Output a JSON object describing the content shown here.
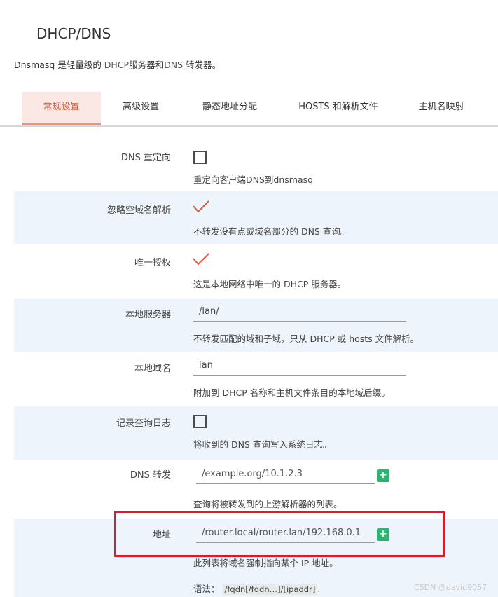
{
  "page": {
    "title": "DHCP/DNS",
    "description_prefix": "Dnsmasq 是轻量级的 ",
    "description_link1": "DHCP",
    "description_mid": "服务器和",
    "description_link2": "DNS",
    "description_suffix": " 转发器。"
  },
  "tabs": [
    {
      "label": "常规设置",
      "active": true
    },
    {
      "label": "高级设置",
      "active": false
    },
    {
      "label": "静态地址分配",
      "active": false
    },
    {
      "label": "HOSTS 和解析文件",
      "active": false
    },
    {
      "label": "主机名映射",
      "active": false
    }
  ],
  "fields": {
    "dns_redirect": {
      "label": "DNS 重定向",
      "checked": false,
      "help": "重定向客户端DNS到dnsmasq"
    },
    "ignore_empty_domain": {
      "label": "忽略空域名解析",
      "checked": true,
      "help": "不转发没有点或域名部分的 DNS 查询。"
    },
    "authoritative": {
      "label": "唯一授权",
      "checked": true,
      "help": "这是本地网络中唯一的 DHCP 服务器。"
    },
    "local_server": {
      "label": "本地服务器",
      "value": "/lan/",
      "help": "不转发匹配的域和子域，只从 DHCP 或 hosts 文件解析。"
    },
    "local_domain": {
      "label": "本地域名",
      "value": "lan",
      "help": "附加到 DHCP 名称和主机文件条目的本地域后缀。"
    },
    "log_queries": {
      "label": "记录查询日志",
      "checked": false,
      "help": "将收到的 DNS 查询写入系统日志。"
    },
    "dns_forward": {
      "label": "DNS 转发",
      "placeholder": "/example.org/10.1.2.3",
      "add": "+",
      "help": "查询将被转发到的上游解析器的列表。"
    },
    "address": {
      "label": "地址",
      "placeholder": "/router.local/router.lan/192.168.0.1",
      "add": "+",
      "help": "此列表将域名强制指向某个 IP 地址。",
      "syntax_label": "语法：",
      "syntax_code": "/fqdn[/fqdn…]/[ipaddr]",
      "syntax_end": "."
    }
  },
  "watermark": "CSDN @david9057",
  "colors": {
    "accent": "#e05a3c",
    "tab_active_bg": "#fbe7e3",
    "row_shade": "#eef4fb",
    "add_button": "#2db36f",
    "highlight_box": "#e0162b"
  }
}
